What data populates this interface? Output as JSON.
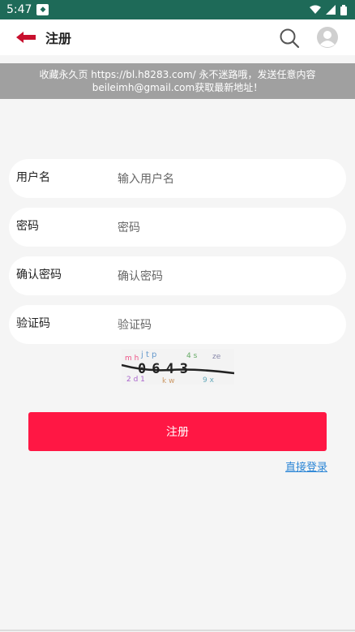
{
  "status_bar": {
    "time": "5:47",
    "app_icon": "app-badge-icon"
  },
  "header": {
    "title": "注册",
    "back_icon": "back-arrow-icon",
    "search_icon": "search-icon",
    "avatar_icon": "avatar-icon"
  },
  "notice": {
    "line1": "收藏永久页 https://bl.h8283.com/ 永不迷路哦，发送任意内容",
    "line2": "beileimh@gmail.com获取最新地址！"
  },
  "form": {
    "username": {
      "label": "用户名",
      "placeholder": "输入用户名"
    },
    "password": {
      "label": "密码",
      "placeholder": "密码"
    },
    "confirm": {
      "label": "确认密码",
      "placeholder": "确认密码"
    },
    "captcha": {
      "label": "验证码",
      "placeholder": "验证码",
      "image_text": "0643"
    }
  },
  "actions": {
    "register_label": "注册",
    "login_link": "直接登录"
  },
  "colors": {
    "status_bar": "#1e6a58",
    "accent": "#ff1744",
    "link": "#2c86d6",
    "notice_bg": "#a0a0a0"
  }
}
